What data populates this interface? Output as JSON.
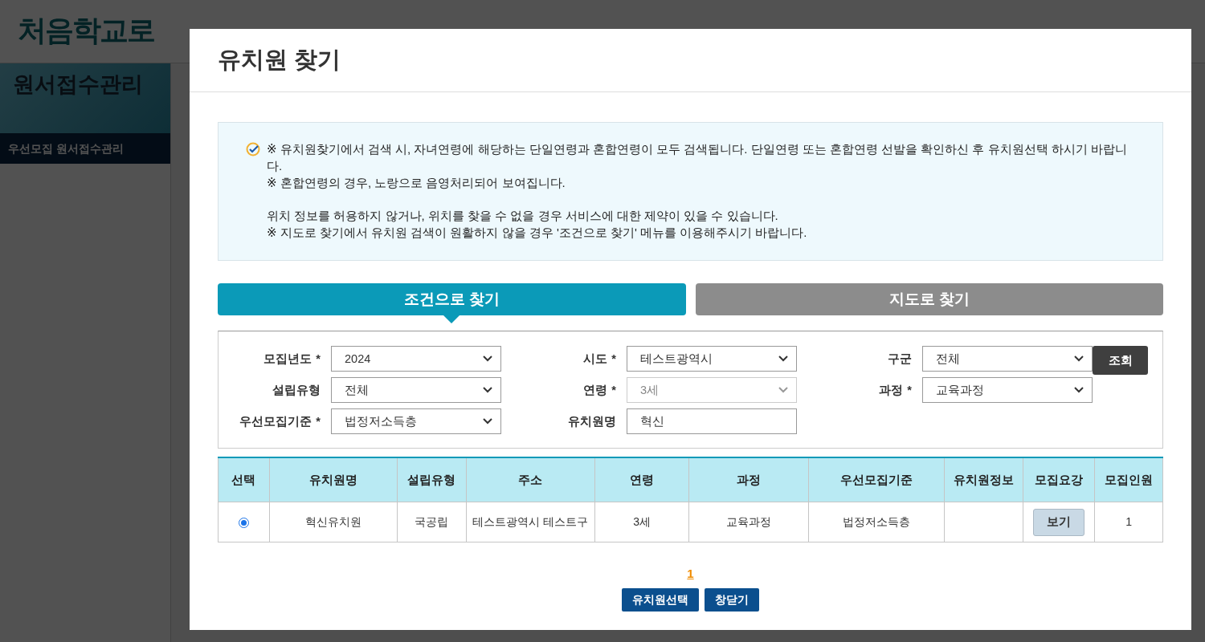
{
  "background": {
    "logo": "처음학교로",
    "sidebar": {
      "title": "원서접수관리",
      "items": [
        {
          "label": "우선모집 원서접수관리",
          "selected": true
        }
      ]
    }
  },
  "modal": {
    "title": "유치원 찾기",
    "notice": [
      [
        "※ 유치원찾기에서 검색 시, 자녀연령에 해당하는 단일연령과 혼합연령이 모두 검색됩니다. 단일연령 또는 혼합연령 선발을 확인하신 후 유치원선택 하시기 바랍니다.",
        "※ 혼합연령의 경우, 노랑으로 음영처리되어 보여집니다."
      ],
      [
        "위치 정보를 허용하지 않거나, 위치를 찾을 수 없을 경우 서비스에 대한 제약이 있을 수 있습니다.",
        "※ 지도로 찾기에서 유치원 검색이 원활하지 않을 경우 '조건으로 찾기' 메뉴를 이용해주시기 바랍니다."
      ]
    ],
    "tabs": [
      {
        "label": "조건으로 찾기",
        "selected": true
      },
      {
        "label": "지도로 찾기",
        "selected": false
      }
    ],
    "filters": [
      {
        "label": "모집년도",
        "required_mark": "*",
        "kind": "select",
        "value": "2024",
        "disabled": false
      },
      {
        "label": "시도",
        "required_mark": "*",
        "kind": "select",
        "value": "테스트광역시",
        "disabled": false
      },
      {
        "label": "구군",
        "kind": "select",
        "value": "전체",
        "disabled": false
      },
      {
        "label": "설립유형",
        "kind": "select",
        "value": "전체",
        "disabled": false
      },
      {
        "label": "연령",
        "required_mark": "*",
        "kind": "select",
        "value": "3세",
        "disabled": true
      },
      {
        "label": "과정",
        "required_mark": "*",
        "kind": "select",
        "value": "교육과정",
        "disabled": false
      },
      {
        "label": "우선모집기준",
        "required_mark": "*",
        "kind": "select",
        "value": "법정저소득층",
        "disabled": false
      },
      {
        "label": "유치원명",
        "kind": "text",
        "value": "혁신",
        "disabled": false
      }
    ],
    "search_button": "조회",
    "table": {
      "columns": [
        "선택",
        "유치원명",
        "설립유형",
        "주소",
        "연령",
        "과정",
        "우선모집기준",
        "유치원정보",
        "모집요강",
        "모집인원"
      ],
      "rows": [
        {
          "selected": true,
          "name": "혁신유치원",
          "type": "국공립",
          "address": "테스트광역시 테스트구",
          "age": "3세",
          "course": "교육과정",
          "priority": "법정저소득층",
          "guide_button": "보기",
          "capacity": "1"
        }
      ]
    },
    "pagination": [
      {
        "label": "1",
        "selected": true
      }
    ],
    "buttons": [
      "유치원선택",
      "창닫기"
    ]
  }
}
